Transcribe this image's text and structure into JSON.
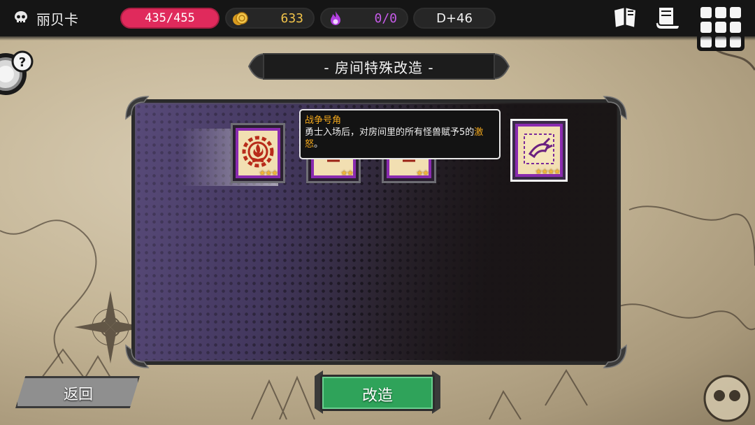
{
  "player": {
    "name": "丽贝卡"
  },
  "stats": {
    "hp": "435/455",
    "gold": "633",
    "souls": "0/0",
    "day": "D+46"
  },
  "title": "- 房间特殊改造 -",
  "cards": [
    {
      "icon": "campfire-gear-icon",
      "stars": "★★★"
    },
    {
      "icon": "blood-rune-icon",
      "stars": "★★"
    },
    {
      "icon": "blood-rune-icon",
      "stars": "★★"
    },
    {
      "icon": "spiked-horn-icon",
      "stars": "★★★★"
    }
  ],
  "tooltip": {
    "title": "战争号角",
    "body_before": "勇士入场后，对房间里的所有怪兽赋予5的",
    "highlight": "激怒",
    "body_after": "。"
  },
  "buttons": {
    "back": "返回",
    "modify": "改造"
  },
  "colors": {
    "hp": "#e02a5c",
    "gold": "#f1c34a",
    "soul": "#c65be8",
    "confirm": "#2fa35a",
    "highlight": "#f2a81c"
  }
}
